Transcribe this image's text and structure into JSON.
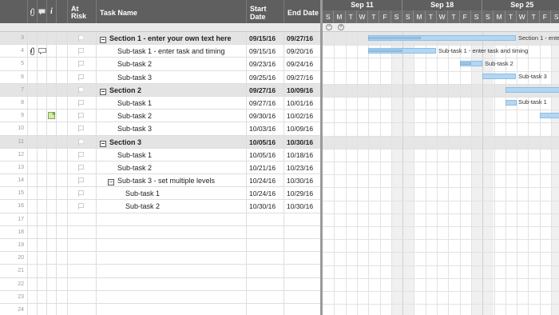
{
  "grid": {
    "headers": {
      "at_risk": "At Risk",
      "task_name": "Task Name",
      "start_date": "Start Date",
      "end_date": "End Date"
    },
    "rows": [
      {
        "num": "3",
        "name": "Section 1 - enter your own text here",
        "start": "09/15/16",
        "end": "09/27/16"
      },
      {
        "num": "4",
        "name": "Sub-task 1 - enter task and timing",
        "start": "09/15/16",
        "end": "09/20/16"
      },
      {
        "num": "5",
        "name": "Sub-task 2",
        "start": "09/23/16",
        "end": "09/24/16"
      },
      {
        "num": "6",
        "name": "Sub-task 3",
        "start": "09/25/16",
        "end": "09/27/16"
      },
      {
        "num": "7",
        "name": "Section 2",
        "start": "09/27/16",
        "end": "10/09/16"
      },
      {
        "num": "8",
        "name": "Sub-task 1",
        "start": "09/27/16",
        "end": "10/01/16"
      },
      {
        "num": "9",
        "name": "Sub-task 2",
        "start": "09/30/16",
        "end": "10/02/16"
      },
      {
        "num": "10",
        "name": "Sub-task 3",
        "start": "10/03/16",
        "end": "10/09/16"
      },
      {
        "num": "11",
        "name": "Section 3",
        "start": "10/05/16",
        "end": "10/30/16"
      },
      {
        "num": "12",
        "name": "Sub-task 1",
        "start": "10/05/16",
        "end": "10/18/16"
      },
      {
        "num": "13",
        "name": "Sub-task 2",
        "start": "10/21/16",
        "end": "10/23/16"
      },
      {
        "num": "14",
        "name": "Sub-task 3 - set multiple levels",
        "start": "10/24/16",
        "end": "10/30/16"
      },
      {
        "num": "15",
        "name": "Sub-task 1",
        "start": "10/24/16",
        "end": "10/29/16"
      },
      {
        "num": "16",
        "name": "Sub-task 2",
        "start": "10/30/16",
        "end": "10/30/16"
      },
      {
        "num": "17",
        "name": "",
        "start": "",
        "end": ""
      },
      {
        "num": "18",
        "name": "",
        "start": "",
        "end": ""
      },
      {
        "num": "19",
        "name": "",
        "start": "",
        "end": ""
      },
      {
        "num": "20",
        "name": "",
        "start": "",
        "end": ""
      },
      {
        "num": "21",
        "name": "",
        "start": "",
        "end": ""
      },
      {
        "num": "22",
        "name": "",
        "start": "",
        "end": ""
      },
      {
        "num": "23",
        "name": "",
        "start": "",
        "end": ""
      },
      {
        "num": "24",
        "name": "",
        "start": "",
        "end": ""
      }
    ]
  },
  "gantt": {
    "weeks": [
      "Sep 11",
      "Sep 18",
      "Sep 25"
    ],
    "days": [
      "S",
      "M",
      "T",
      "W",
      "T",
      "F",
      "S",
      "S",
      "M",
      "T",
      "W",
      "T",
      "F",
      "S",
      "S",
      "M",
      "T",
      "W",
      "T",
      "F",
      "S"
    ],
    "bar_labels": {
      "section1": "Section 1 - enter",
      "s1_task1": "Sub-task 1 - enter task and timing",
      "s1_task2": "Sub-task 2",
      "s1_task3": "Sub-task 3",
      "s2_task1": "Sub-task 1"
    }
  },
  "colors": {
    "header_bg": "#5f5f5f",
    "section_bg": "#e4e4e4",
    "bar_fill": "#b3d6f2",
    "bar_border": "#8dbde4"
  }
}
